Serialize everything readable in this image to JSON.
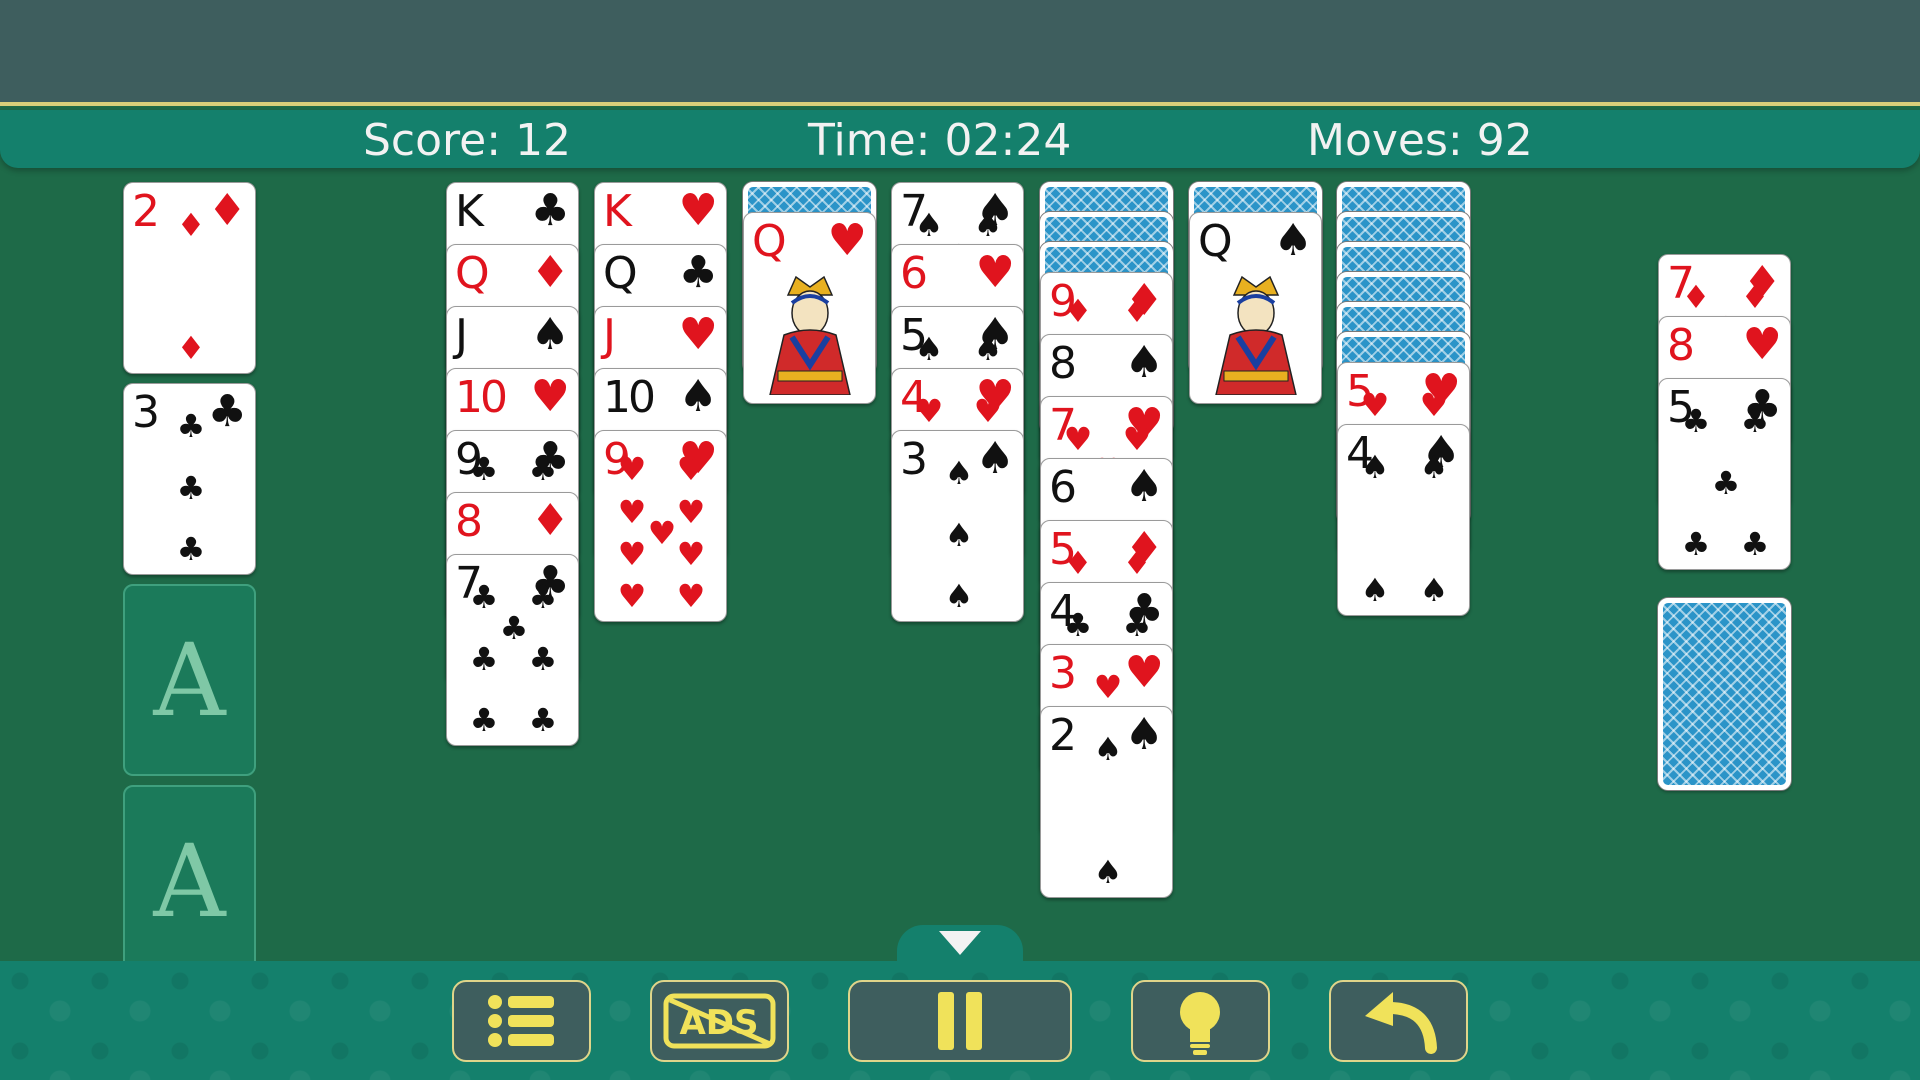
{
  "hud": {
    "score_label": "Score:",
    "score_value": "12",
    "time_label": "Time:",
    "time_value": "02:24",
    "moves_label": "Moves:",
    "moves_value": "92"
  },
  "colors": {
    "felt": "#1e6a48",
    "hud": "#14806c",
    "accent_gold": "#dfd58a",
    "button_fill": "#3e5e5e",
    "red_suit": "#e0141e",
    "black_suit": "#111111",
    "card_back": "#2b94c8"
  },
  "foundations": [
    {
      "type": "card",
      "rank": "2",
      "suit": "♦",
      "color": "red"
    },
    {
      "type": "card",
      "rank": "3",
      "suit": "♣",
      "color": "black"
    },
    {
      "type": "slot",
      "label": "A"
    },
    {
      "type": "slot",
      "label": "A"
    }
  ],
  "tableau": [
    {
      "id": "col1",
      "cards": [
        {
          "rank": "K",
          "suit": "♣",
          "color": "black"
        },
        {
          "rank": "Q",
          "suit": "♦",
          "color": "red"
        },
        {
          "rank": "J",
          "suit": "♠",
          "color": "black"
        },
        {
          "rank": "10",
          "suit": "♥",
          "color": "red"
        },
        {
          "rank": "9",
          "suit": "♣",
          "color": "black"
        },
        {
          "rank": "8",
          "suit": "♦",
          "color": "red"
        },
        {
          "rank": "7",
          "suit": "♣",
          "color": "black"
        }
      ]
    },
    {
      "id": "col2",
      "cards": [
        {
          "rank": "K",
          "suit": "♥",
          "color": "red"
        },
        {
          "rank": "Q",
          "suit": "♣",
          "color": "black"
        },
        {
          "rank": "J",
          "suit": "♥",
          "color": "red"
        },
        {
          "rank": "10",
          "suit": "♠",
          "color": "black"
        },
        {
          "rank": "9",
          "suit": "♥",
          "color": "red"
        }
      ]
    },
    {
      "id": "col3",
      "cards": [
        {
          "back": true
        },
        {
          "rank": "Q",
          "suit": "♥",
          "color": "red",
          "face": true
        }
      ]
    },
    {
      "id": "col4",
      "cards": [
        {
          "rank": "7",
          "suit": "♠",
          "color": "black"
        },
        {
          "rank": "6",
          "suit": "♥",
          "color": "red"
        },
        {
          "rank": "5",
          "suit": "♠",
          "color": "black"
        },
        {
          "rank": "4",
          "suit": "♥",
          "color": "red"
        },
        {
          "rank": "3",
          "suit": "♠",
          "color": "black"
        }
      ]
    },
    {
      "id": "col5",
      "cards": [
        {
          "back": true
        },
        {
          "back": true
        },
        {
          "back": true
        },
        {
          "rank": "9",
          "suit": "♦",
          "color": "red"
        },
        {
          "rank": "8",
          "suit": "♠",
          "color": "black"
        },
        {
          "rank": "7",
          "suit": "♥",
          "color": "red"
        },
        {
          "rank": "6",
          "suit": "♠",
          "color": "black"
        },
        {
          "rank": "5",
          "suit": "♦",
          "color": "red"
        },
        {
          "rank": "4",
          "suit": "♣",
          "color": "black"
        },
        {
          "rank": "3",
          "suit": "♥",
          "color": "red"
        },
        {
          "rank": "2",
          "suit": "♠",
          "color": "black"
        }
      ]
    },
    {
      "id": "col6",
      "cards": [
        {
          "back": true
        },
        {
          "rank": "Q",
          "suit": "♠",
          "color": "black",
          "face": true
        }
      ]
    },
    {
      "id": "col7",
      "cards": [
        {
          "back": true
        },
        {
          "back": true
        },
        {
          "back": true
        },
        {
          "back": true
        },
        {
          "back": true
        },
        {
          "back": true
        },
        {
          "rank": "5",
          "suit": "♥",
          "color": "red"
        },
        {
          "rank": "4",
          "suit": "♠",
          "color": "black"
        }
      ]
    }
  ],
  "waste": [
    {
      "rank": "7",
      "suit": "♦",
      "color": "red"
    },
    {
      "rank": "8",
      "suit": "♥",
      "color": "red"
    },
    {
      "rank": "5",
      "suit": "♣",
      "color": "black"
    }
  ],
  "stock": {
    "back": true
  },
  "toolbar": {
    "menu": {
      "icon": "menu-list-icon"
    },
    "ads": {
      "icon": "no-ads-icon",
      "label": "ADS"
    },
    "pause": {
      "icon": "pause-icon"
    },
    "hint": {
      "icon": "lightbulb-icon"
    },
    "undo": {
      "icon": "undo-arrow-icon"
    },
    "drawer": {
      "icon": "chevron-down-icon"
    }
  }
}
